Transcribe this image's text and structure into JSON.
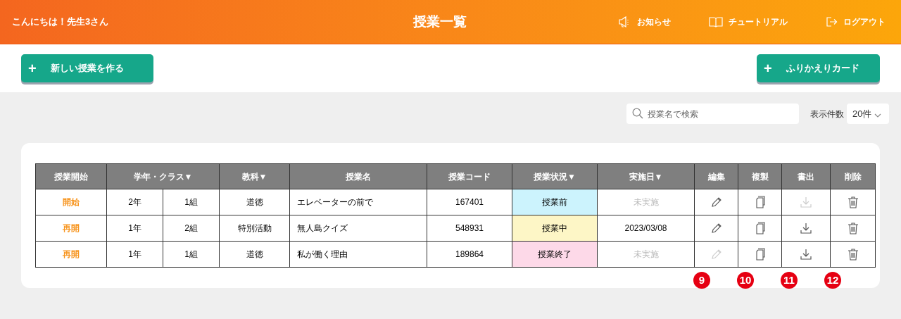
{
  "header": {
    "greeting": "こんにちは！先生3さん",
    "title": "授業一覧",
    "nav": [
      {
        "kind": "megaphone",
        "label": "お知らせ"
      },
      {
        "kind": "book",
        "label": "チュートリアル"
      },
      {
        "kind": "logout",
        "label": "ログアウト"
      }
    ]
  },
  "actions": [
    {
      "icon": "+",
      "label": "新しい授業を作る"
    },
    {
      "icon": "+",
      "label": "ふりかえりカード"
    }
  ],
  "search": {
    "placeholder": "授業名で検索"
  },
  "page_size": {
    "label": "表示件数",
    "value": "20件"
  },
  "table": {
    "columns": [
      "授業開始",
      "学年・クラス▼",
      "教科▼",
      "授業名",
      "授業コード",
      "授業状況▼",
      "実施日▼",
      "編集",
      "複製",
      "書出",
      "削除"
    ],
    "rows": [
      {
        "start": "開始",
        "grade": "2年",
        "class": "1組",
        "subject": "道徳",
        "name": "エレベーターの前で",
        "code": "167401",
        "status": "授業前",
        "color": "#ccf3fd",
        "date": "未実施",
        "date_done": false,
        "edit_disabled": false,
        "export_disabled": true
      },
      {
        "start": "再開",
        "grade": "1年",
        "class": "2組",
        "subject": "特別活動",
        "name": "無人島クイズ",
        "code": "548931",
        "status": "授業中",
        "color": "#fdf6c6",
        "date": "2023/03/08",
        "date_done": true,
        "edit_disabled": false,
        "export_disabled": false
      },
      {
        "start": "再開",
        "grade": "1年",
        "class": "1組",
        "subject": "道徳",
        "name": "私が働く理由",
        "code": "189864",
        "status": "授業終了",
        "color": "#fdd9e8",
        "date": "未実施",
        "date_done": false,
        "edit_disabled": true,
        "export_disabled": false
      }
    ]
  },
  "callouts": [
    "9",
    "10",
    "11",
    "12"
  ]
}
